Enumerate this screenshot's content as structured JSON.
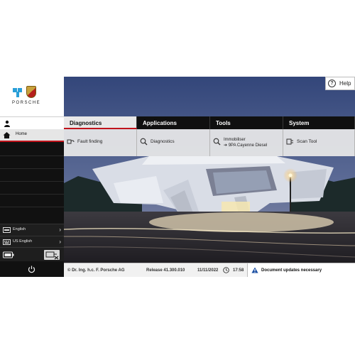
{
  "brand": {
    "wordmark": "PORSCHE"
  },
  "sidebar": {
    "home_label": "Home",
    "language_label": "English",
    "keyboard_label": "US English",
    "chevron": "›"
  },
  "help": {
    "label": "Help",
    "icon_glyph": "?"
  },
  "menu": {
    "tabs": [
      {
        "label": "Diagnostics",
        "item": "Fault finding",
        "icon": "fault-finding-icon"
      },
      {
        "label": "Applications",
        "item": "Diagnostics",
        "icon": "magnifier-icon"
      },
      {
        "label": "Tools",
        "item_line1": "Immobiliser",
        "item_line2": "➔ 9PA Cayenne Diesel",
        "icon": "magnifier-icon"
      },
      {
        "label": "System",
        "item": "Scan Tool",
        "icon": "scan-tool-icon"
      }
    ]
  },
  "status": {
    "copyright": "© Dr. Ing. h.c. F. Porsche AG",
    "release": "Release 41.300.010",
    "date": "11/11/2022",
    "time": "17:58",
    "notice": "Document updates necessary"
  },
  "colors": {
    "accent": "#c0141c",
    "warning": "#1b4fa3"
  }
}
